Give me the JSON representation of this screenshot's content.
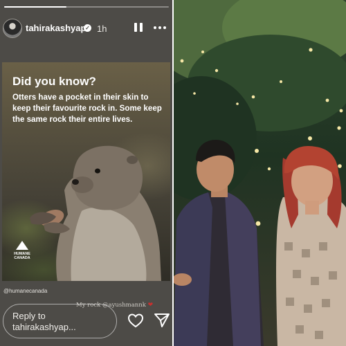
{
  "story": {
    "progress": 0.38,
    "username": "tahirakashyap",
    "verified_badge": "verified-badge-icon",
    "time_ago": "1h",
    "card": {
      "title": "Did you know?",
      "body": "Otters have a pocket in their skin to keep their favourite rock in. Some keep the same rock their entire lives.",
      "logo_text": "HUMANE CANADA"
    },
    "mention": "@humanecanada",
    "caption": "My rock @ayushmannk",
    "reply_placeholder": "Reply to tahirakashyap...",
    "icons": {
      "pause": "pause-icon",
      "more": "more-options-icon",
      "like": "heart-outline-icon",
      "share": "send-icon"
    }
  },
  "colors": {
    "story_bg": "#4d4b47",
    "heart_red": "#c7302f"
  }
}
